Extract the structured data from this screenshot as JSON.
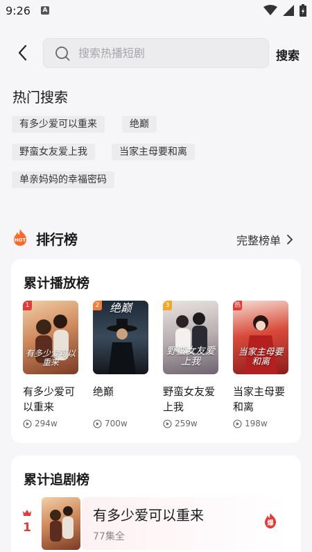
{
  "status_bar": {
    "time": "9:26",
    "app_badge": "A"
  },
  "search": {
    "placeholder": "搜索热播短剧",
    "button_label": "搜索"
  },
  "hot_search": {
    "title": "热门搜索",
    "tags": [
      "有多少爱可以重来",
      "绝巅",
      "野蛮女友爱上我",
      "当家主母要和离",
      "单亲妈妈的幸福密码"
    ]
  },
  "ranking": {
    "title": "排行榜",
    "icon_label": "HOT",
    "full_list_label": "完整榜单",
    "cumulative_play": {
      "title": "累计播放榜",
      "items": [
        {
          "badge": "1",
          "name": "有多少爱可以重来",
          "plays": "294w",
          "poster_text": "有多少爱可以重来",
          "badge_color": "#e53935"
        },
        {
          "badge": "2",
          "name": "绝巅",
          "plays": "700w",
          "poster_text": "绝巅",
          "badge_color": "#f0803c"
        },
        {
          "badge": "3",
          "name": "野蛮女友爱上我",
          "plays": "259w",
          "poster_text": "野蛮女友爱上我",
          "badge_color": "#f4a629"
        },
        {
          "badge": "热",
          "name": "当家主母要和离",
          "plays": "198w",
          "poster_text": "当家主母要和离",
          "badge_color": "#e53935"
        }
      ]
    },
    "cumulative_follow": {
      "title": "累计追剧榜",
      "items": [
        {
          "rank": "1",
          "name": "有多少爱可以重来",
          "episodes": "77集全",
          "tag": "爆"
        }
      ]
    }
  },
  "colors": {
    "accent_red": "#e53935",
    "hot_orange": "#ff6a2b"
  }
}
